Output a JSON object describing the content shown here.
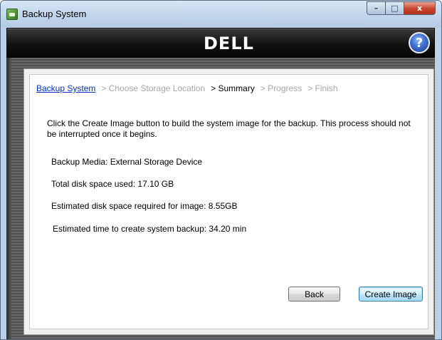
{
  "window": {
    "title": "Backup System",
    "controls": {
      "minimize": "–",
      "maximize": "□",
      "close": "x"
    }
  },
  "banner": {
    "logo_text": "DELL",
    "help_symbol": "?"
  },
  "breadcrumb": {
    "items": [
      {
        "label": "Backup System",
        "state": "link"
      },
      {
        "label": "> Choose Storage Location",
        "state": "disabled"
      },
      {
        "label": "> Summary",
        "state": "current"
      },
      {
        "label": "> Progress",
        "state": "disabled"
      },
      {
        "label": "> Finish",
        "state": "disabled"
      }
    ]
  },
  "content": {
    "intro": "Click the Create Image button to build the system image for the backup. This process should not be interrupted once it begins.",
    "backup_media": "Backup Media:   External Storage Device",
    "disk_used": "Total disk space used:   17.10 GB",
    "space_required": "Estimated disk space required for image:  8.55GB",
    "time_estimate": "Estimated time to create system backup:   34.20 min"
  },
  "buttons": {
    "back": "Back",
    "create_image": "Create Image"
  },
  "colors": {
    "link": "#0033cc",
    "disabled": "#a7a7a7",
    "banner": "#121212"
  }
}
